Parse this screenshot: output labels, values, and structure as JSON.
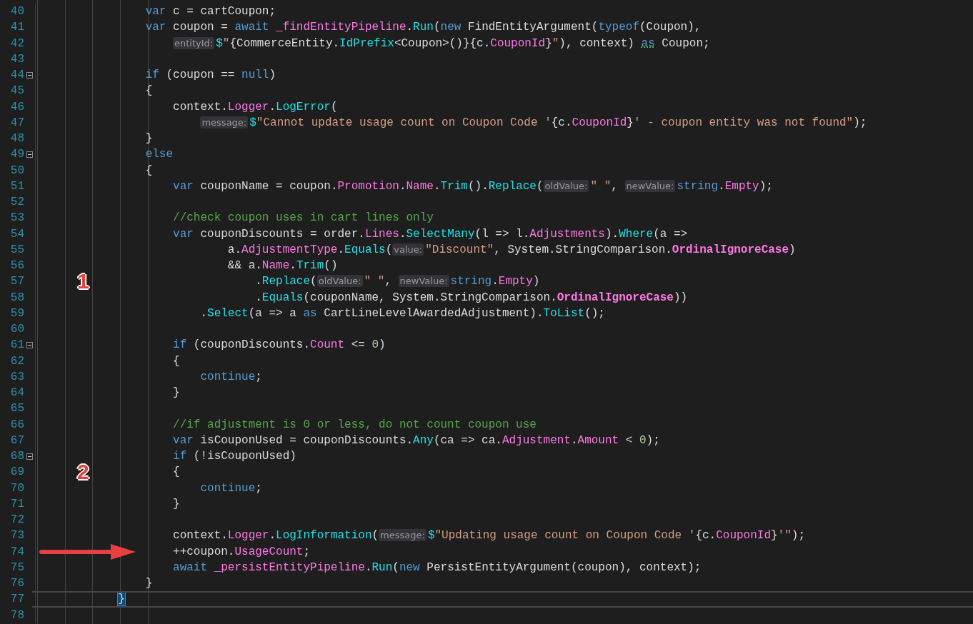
{
  "editor": {
    "lines": [
      {
        "number": "40",
        "fold": false,
        "current": false,
        "tokens": [
          {
            "kind": "kw",
            "text": "                var"
          },
          {
            "kind": "p",
            "text": " c = cartCoupon;"
          }
        ]
      },
      {
        "number": "41",
        "fold": false,
        "current": false,
        "tokens": [
          {
            "kind": "kw",
            "text": "                var"
          },
          {
            "kind": "p",
            "text": " coupon = "
          },
          {
            "kind": "kw",
            "text": "await "
          },
          {
            "kind": "mem",
            "text": "_findEntityPipeline"
          },
          {
            "kind": "p",
            "text": "."
          },
          {
            "kind": "fn",
            "text": "Run"
          },
          {
            "kind": "p",
            "text": "("
          },
          {
            "kind": "kw",
            "text": "new"
          },
          {
            "kind": "p",
            "text": " FindEntityArgument("
          },
          {
            "kind": "kw",
            "text": "typeof"
          },
          {
            "kind": "p",
            "text": "(Coupon),"
          }
        ]
      },
      {
        "number": "42",
        "fold": false,
        "current": false,
        "tokens": [
          {
            "kind": "hint",
            "text": "                    entityId:"
          },
          {
            "kind": "fn",
            "text": "$"
          },
          {
            "kind": "str",
            "text": "\""
          },
          {
            "kind": "p",
            "text": "{CommerceEntity."
          },
          {
            "kind": "fn",
            "text": "IdPrefix"
          },
          {
            "kind": "p",
            "text": "<Coupon>()}{c."
          },
          {
            "kind": "mem",
            "text": "CouponId"
          },
          {
            "kind": "p",
            "text": "}"
          },
          {
            "kind": "str",
            "text": "\""
          },
          {
            "kind": "p",
            "text": "), context) "
          },
          {
            "kind": "sq",
            "text": "as"
          },
          {
            "kind": "p",
            "text": " Coupon;"
          }
        ]
      },
      {
        "number": "43",
        "fold": false,
        "current": false
      },
      {
        "number": "44",
        "fold": true,
        "current": false,
        "tokens": [
          {
            "kind": "kw",
            "text": "                if"
          },
          {
            "kind": "p",
            "text": " (coupon == "
          },
          {
            "kind": "kw",
            "text": "null"
          },
          {
            "kind": "p",
            "text": ")"
          }
        ]
      },
      {
        "number": "45",
        "fold": false,
        "current": false,
        "tokens": [
          {
            "kind": "p",
            "text": "                {"
          }
        ]
      },
      {
        "number": "46",
        "fold": false,
        "current": false,
        "tokens": [
          {
            "kind": "p",
            "text": "                    context."
          },
          {
            "kind": "mem",
            "text": "Logger"
          },
          {
            "kind": "p",
            "text": "."
          },
          {
            "kind": "fn",
            "text": "LogError"
          },
          {
            "kind": "p",
            "text": "("
          }
        ]
      },
      {
        "number": "47",
        "fold": false,
        "current": false,
        "tokens": [
          {
            "kind": "hint",
            "text": "                        message:"
          },
          {
            "kind": "fn",
            "text": "$"
          },
          {
            "kind": "str",
            "text": "\"Cannot update usage count on Coupon Code '"
          },
          {
            "kind": "p",
            "text": "{c."
          },
          {
            "kind": "mem",
            "text": "CouponId"
          },
          {
            "kind": "p",
            "text": "}"
          },
          {
            "kind": "str",
            "text": "' - coupon entity was not found\""
          },
          {
            "kind": "p",
            "text": ");"
          }
        ]
      },
      {
        "number": "48",
        "fold": false,
        "current": false,
        "tokens": [
          {
            "kind": "p",
            "text": "                }"
          }
        ]
      },
      {
        "number": "49",
        "fold": true,
        "current": false,
        "tokens": [
          {
            "kind": "kw",
            "text": "                else"
          }
        ]
      },
      {
        "number": "50",
        "fold": false,
        "current": false,
        "tokens": [
          {
            "kind": "p",
            "text": "                {"
          }
        ]
      },
      {
        "number": "51",
        "fold": false,
        "current": false,
        "tokens": [
          {
            "kind": "kw",
            "text": "                    var"
          },
          {
            "kind": "p",
            "text": " couponName = coupon."
          },
          {
            "kind": "mem",
            "text": "Promotion"
          },
          {
            "kind": "p",
            "text": "."
          },
          {
            "kind": "mem",
            "text": "Name"
          },
          {
            "kind": "p",
            "text": "."
          },
          {
            "kind": "fn",
            "text": "Trim"
          },
          {
            "kind": "p",
            "text": "()."
          },
          {
            "kind": "fn",
            "text": "Replace"
          },
          {
            "kind": "p",
            "text": "("
          },
          {
            "kind": "hint",
            "text": "oldValue:"
          },
          {
            "kind": "str",
            "text": "\" \""
          },
          {
            "kind": "p",
            "text": ", "
          },
          {
            "kind": "hint",
            "text": "newValue:"
          },
          {
            "kind": "kw",
            "text": "string"
          },
          {
            "kind": "p",
            "text": "."
          },
          {
            "kind": "mem",
            "text": "Empty"
          },
          {
            "kind": "p",
            "text": ");"
          }
        ]
      },
      {
        "number": "52",
        "fold": false,
        "current": false
      },
      {
        "number": "53",
        "fold": false,
        "current": false,
        "tokens": [
          {
            "kind": "cm",
            "text": "                    //check coupon uses in cart lines only"
          }
        ]
      },
      {
        "number": "54",
        "fold": false,
        "current": false,
        "tokens": [
          {
            "kind": "kw",
            "text": "                    var"
          },
          {
            "kind": "p",
            "text": " couponDiscounts = order."
          },
          {
            "kind": "mem",
            "text": "Lines"
          },
          {
            "kind": "p",
            "text": "."
          },
          {
            "kind": "fn",
            "text": "SelectMany"
          },
          {
            "kind": "p",
            "text": "(l => l."
          },
          {
            "kind": "mem",
            "text": "Adjustments"
          },
          {
            "kind": "p",
            "text": ")."
          },
          {
            "kind": "fn",
            "text": "Where"
          },
          {
            "kind": "p",
            "text": "(a =>"
          }
        ]
      },
      {
        "number": "55",
        "fold": false,
        "current": false,
        "tokens": [
          {
            "kind": "p",
            "text": "                            a."
          },
          {
            "kind": "mem",
            "text": "AdjustmentType"
          },
          {
            "kind": "p",
            "text": "."
          },
          {
            "kind": "fn",
            "text": "Equals"
          },
          {
            "kind": "p",
            "text": "("
          },
          {
            "kind": "hint",
            "text": "value:"
          },
          {
            "kind": "str",
            "text": "\"Discount\""
          },
          {
            "kind": "p",
            "text": ", System.StringComparison."
          },
          {
            "kind": "st",
            "text": "OrdinalIgnoreCase"
          },
          {
            "kind": "p",
            "text": ")"
          }
        ]
      },
      {
        "number": "56",
        "fold": false,
        "current": false,
        "tokens": [
          {
            "kind": "p",
            "text": "                            && a."
          },
          {
            "kind": "mem",
            "text": "Name"
          },
          {
            "kind": "p",
            "text": "."
          },
          {
            "kind": "fn",
            "text": "Trim"
          },
          {
            "kind": "p",
            "text": "()"
          }
        ]
      },
      {
        "number": "57",
        "fold": false,
        "current": false,
        "marker": {
          "kind": "number",
          "text": "1"
        },
        "tokens": [
          {
            "kind": "p",
            "text": "                                ."
          },
          {
            "kind": "fn",
            "text": "Replace"
          },
          {
            "kind": "p",
            "text": "("
          },
          {
            "kind": "hint",
            "text": "oldValue:"
          },
          {
            "kind": "str",
            "text": "\" \""
          },
          {
            "kind": "p",
            "text": ", "
          },
          {
            "kind": "hint",
            "text": "newValue:"
          },
          {
            "kind": "kw",
            "text": "string"
          },
          {
            "kind": "p",
            "text": "."
          },
          {
            "kind": "mem",
            "text": "Empty"
          },
          {
            "kind": "p",
            "text": ")"
          }
        ]
      },
      {
        "number": "58",
        "fold": false,
        "current": false,
        "tokens": [
          {
            "kind": "p",
            "text": "                                ."
          },
          {
            "kind": "fn",
            "text": "Equals"
          },
          {
            "kind": "p",
            "text": "(couponName, System.StringComparison."
          },
          {
            "kind": "st",
            "text": "OrdinalIgnoreCase"
          },
          {
            "kind": "p",
            "text": "))"
          }
        ]
      },
      {
        "number": "59",
        "fold": false,
        "current": false,
        "tokens": [
          {
            "kind": "p",
            "text": "                        ."
          },
          {
            "kind": "fn",
            "text": "Select"
          },
          {
            "kind": "p",
            "text": "(a => a "
          },
          {
            "kind": "kw",
            "text": "as"
          },
          {
            "kind": "p",
            "text": " CartLineLevelAwardedAdjustment)."
          },
          {
            "kind": "fn",
            "text": "ToList"
          },
          {
            "kind": "p",
            "text": "();"
          }
        ]
      },
      {
        "number": "60",
        "fold": false,
        "current": false
      },
      {
        "number": "61",
        "fold": true,
        "current": false,
        "tokens": [
          {
            "kind": "kw",
            "text": "                    if"
          },
          {
            "kind": "p",
            "text": " (couponDiscounts."
          },
          {
            "kind": "mem",
            "text": "Count"
          },
          {
            "kind": "p",
            "text": " <= "
          },
          {
            "kind": "num",
            "text": "0"
          },
          {
            "kind": "p",
            "text": ")"
          }
        ]
      },
      {
        "number": "62",
        "fold": false,
        "current": false,
        "tokens": [
          {
            "kind": "p",
            "text": "                    {"
          }
        ]
      },
      {
        "number": "63",
        "fold": false,
        "current": false,
        "tokens": [
          {
            "kind": "kw",
            "text": "                        continue"
          },
          {
            "kind": "p",
            "text": ";"
          }
        ]
      },
      {
        "number": "64",
        "fold": false,
        "current": false,
        "tokens": [
          {
            "kind": "p",
            "text": "                    }"
          }
        ]
      },
      {
        "number": "65",
        "fold": false,
        "current": false
      },
      {
        "number": "66",
        "fold": false,
        "current": false,
        "tokens": [
          {
            "kind": "cm",
            "text": "                    //if adjustment is 0 or less, do not count coupon use"
          }
        ]
      },
      {
        "number": "67",
        "fold": false,
        "current": false,
        "tokens": [
          {
            "kind": "kw",
            "text": "                    var"
          },
          {
            "kind": "p",
            "text": " isCouponUsed = couponDiscounts."
          },
          {
            "kind": "fn",
            "text": "Any"
          },
          {
            "kind": "p",
            "text": "(ca => ca."
          },
          {
            "kind": "mem",
            "text": "Adjustment"
          },
          {
            "kind": "p",
            "text": "."
          },
          {
            "kind": "mem",
            "text": "Amount"
          },
          {
            "kind": "p",
            "text": " < "
          },
          {
            "kind": "num",
            "text": "0"
          },
          {
            "kind": "p",
            "text": ");"
          }
        ]
      },
      {
        "number": "68",
        "fold": true,
        "current": false,
        "tokens": [
          {
            "kind": "kw",
            "text": "                    if"
          },
          {
            "kind": "p",
            "text": " (!isCouponUsed)"
          }
        ]
      },
      {
        "number": "69",
        "fold": false,
        "current": false,
        "marker": {
          "kind": "number",
          "text": "2"
        },
        "tokens": [
          {
            "kind": "p",
            "text": "                    {"
          }
        ]
      },
      {
        "number": "70",
        "fold": false,
        "current": false,
        "tokens": [
          {
            "kind": "kw",
            "text": "                        continue"
          },
          {
            "kind": "p",
            "text": ";"
          }
        ]
      },
      {
        "number": "71",
        "fold": false,
        "current": false,
        "tokens": [
          {
            "kind": "p",
            "text": "                    }"
          }
        ]
      },
      {
        "number": "72",
        "fold": false,
        "current": false
      },
      {
        "number": "73",
        "fold": false,
        "current": false,
        "tokens": [
          {
            "kind": "p",
            "text": "                    context."
          },
          {
            "kind": "mem",
            "text": "Logger"
          },
          {
            "kind": "p",
            "text": "."
          },
          {
            "kind": "fn",
            "text": "LogInformation"
          },
          {
            "kind": "p",
            "text": "("
          },
          {
            "kind": "hint",
            "text": "message:"
          },
          {
            "kind": "fn",
            "text": "$"
          },
          {
            "kind": "str",
            "text": "\"Updating usage count on Coupon Code '"
          },
          {
            "kind": "p",
            "text": "{c."
          },
          {
            "kind": "mem",
            "text": "CouponId"
          },
          {
            "kind": "p",
            "text": "}"
          },
          {
            "kind": "str",
            "text": "'\""
          },
          {
            "kind": "p",
            "text": ");"
          }
        ]
      },
      {
        "number": "74",
        "fold": false,
        "current": false,
        "marker": {
          "kind": "arrow"
        },
        "tokens": [
          {
            "kind": "p",
            "text": "                    ++coupon."
          },
          {
            "kind": "mem",
            "text": "UsageCount"
          },
          {
            "kind": "p",
            "text": ";"
          }
        ]
      },
      {
        "number": "75",
        "fold": false,
        "current": false,
        "tokens": [
          {
            "kind": "kw",
            "text": "                    await "
          },
          {
            "kind": "mem",
            "text": "_persistEntityPipeline"
          },
          {
            "kind": "p",
            "text": "."
          },
          {
            "kind": "fn",
            "text": "Run"
          },
          {
            "kind": "p",
            "text": "("
          },
          {
            "kind": "kw",
            "text": "new"
          },
          {
            "kind": "p",
            "text": " PersistEntityArgument(coupon), context);"
          }
        ]
      },
      {
        "number": "76",
        "fold": false,
        "current": false,
        "tokens": [
          {
            "kind": "p",
            "text": "                }"
          }
        ]
      },
      {
        "number": "77",
        "fold": false,
        "current": true,
        "tokens": [
          {
            "kind": "match",
            "text": "            }"
          }
        ]
      },
      {
        "number": "78",
        "fold": false,
        "current": false
      }
    ]
  }
}
